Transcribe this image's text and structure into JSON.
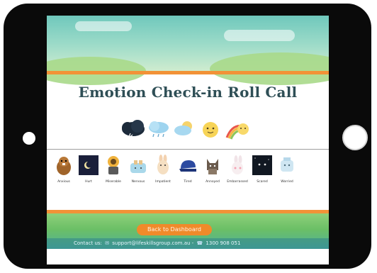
{
  "page": {
    "title": "Emotion Check-in Roll Call"
  },
  "weather_icons": [
    "storm-cloud-icon",
    "rain-cloud-icon",
    "cloud-sun-icon",
    "sun-icon",
    "rainbow-icon"
  ],
  "emotions": [
    {
      "label": "Anxious",
      "icon": "beaver-icon"
    },
    {
      "label": "Hurt",
      "icon": "moon-icon"
    },
    {
      "label": "Miserable",
      "icon": "flower-pot-icon"
    },
    {
      "label": "Nervous",
      "icon": "toaster-icon"
    },
    {
      "label": "Impatient",
      "icon": "rabbit-icon"
    },
    {
      "label": "Tired",
      "icon": "cap-icon"
    },
    {
      "label": "Annoyed",
      "icon": "cat-icon"
    },
    {
      "label": "Embarrassed",
      "icon": "bunny-icon"
    },
    {
      "label": "Scared",
      "icon": "night-box-icon"
    },
    {
      "label": "Worried",
      "icon": "robot-icon"
    }
  ],
  "footer": {
    "dashboard_button": "Back to Dashboard",
    "contact_label": "Contact us:",
    "email": "support@lifeskillsgroup.com.au",
    "separator": "-",
    "phone": "1300 908 051"
  },
  "colors": {
    "accent": "#f29237",
    "title": "#2f4f56",
    "sky": "#6fc8bc",
    "grass": "#6bbf66"
  }
}
